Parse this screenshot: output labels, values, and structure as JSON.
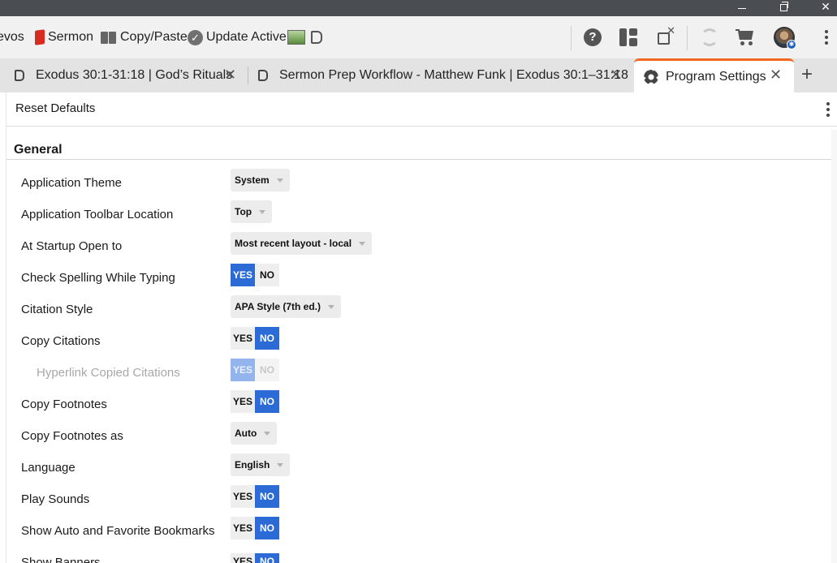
{
  "window": {
    "minimize_icon": "minimize-icon",
    "maximize_icon": "restore-icon",
    "close_glyph": "✕"
  },
  "toolbar": {
    "items": [
      {
        "label": "evos"
      },
      {
        "label": "Sermon",
        "icon": "red-book-icon"
      },
      {
        "label": "Copy/Paste",
        "icon": "pages-icon"
      },
      {
        "label": "Update Active",
        "icon": "checkmark-circle-icon"
      }
    ],
    "help_glyph": "?",
    "avatar_badge": "✱"
  },
  "tabs": [
    {
      "label": "Exodus 30:1-31:18 | God’s Rituals",
      "close": "✕"
    },
    {
      "label": "Sermon Prep Workflow - Matthew Funk | Exodus 30:1–31:18",
      "close": "✕"
    },
    {
      "label": "Program Settings",
      "close": "✕",
      "active": true
    }
  ],
  "add_tab_glyph": "+",
  "actions": {
    "reset_label": "Reset Defaults"
  },
  "section": {
    "title": "General"
  },
  "settings": [
    {
      "label": "Application Theme",
      "type": "dropdown",
      "value": "System"
    },
    {
      "label": "Application Toolbar Location",
      "type": "dropdown",
      "value": "Top"
    },
    {
      "label": "At Startup Open to",
      "type": "dropdown",
      "value": "Most recent layout - local"
    },
    {
      "label": "Check Spelling While Typing",
      "type": "toggle",
      "yes": "YES",
      "no": "NO",
      "selected": "YES"
    },
    {
      "label": "Citation Style",
      "type": "dropdown",
      "value": "APA Style (7th ed.)"
    },
    {
      "label": "Copy Citations",
      "type": "toggle",
      "yes": "YES",
      "no": "NO",
      "selected": "NO"
    },
    {
      "label": "Hyperlink Copied Citations",
      "type": "toggle",
      "yes": "YES",
      "no": "NO",
      "selected": "YES",
      "disabled": true
    },
    {
      "label": "Copy Footnotes",
      "type": "toggle",
      "yes": "YES",
      "no": "NO",
      "selected": "NO"
    },
    {
      "label": "Copy Footnotes as",
      "type": "dropdown",
      "value": "Auto"
    },
    {
      "label": "Language",
      "type": "dropdown",
      "value": "English"
    },
    {
      "label": "Play Sounds",
      "type": "toggle",
      "yes": "YES",
      "no": "NO",
      "selected": "NO"
    },
    {
      "label": "Show Auto and Favorite Bookmarks",
      "type": "toggle",
      "yes": "YES",
      "no": "NO",
      "selected": "NO"
    },
    {
      "label": "Show Banners",
      "type": "toggle",
      "yes": "YES",
      "no": "NO",
      "selected": "NO"
    }
  ],
  "colors": {
    "accent": "#2c6bd6",
    "active_tab": "#f26722",
    "titlebar": "#4a4d52"
  }
}
